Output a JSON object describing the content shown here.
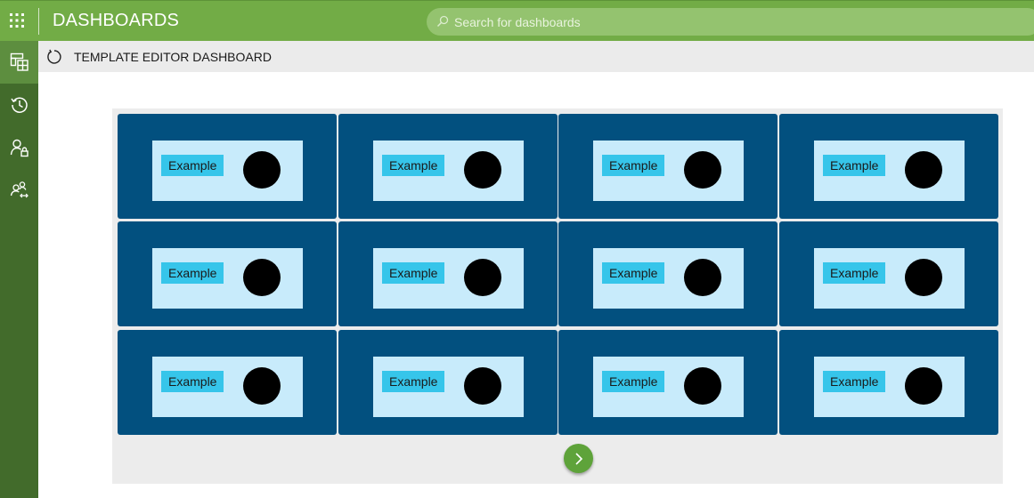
{
  "header": {
    "app_title": "DASHBOARDS",
    "search_placeholder": "Search for dashboards",
    "search_value": ""
  },
  "sidebar": {
    "items": [
      {
        "icon": "dashboard-layout-icon",
        "active": true
      },
      {
        "icon": "history-icon",
        "active": false
      },
      {
        "icon": "user-lock-icon",
        "active": false
      },
      {
        "icon": "users-share-icon",
        "active": false
      }
    ]
  },
  "subheader": {
    "title": "TEMPLATE EDITOR DASHBOARD",
    "refresh_icon": "refresh-icon"
  },
  "dashboard": {
    "tiles": [
      {
        "label": "Example"
      },
      {
        "label": "Example"
      },
      {
        "label": "Example"
      },
      {
        "label": "Example"
      },
      {
        "label": "Example"
      },
      {
        "label": "Example"
      },
      {
        "label": "Example"
      },
      {
        "label": "Example"
      },
      {
        "label": "Example"
      },
      {
        "label": "Example"
      },
      {
        "label": "Example"
      },
      {
        "label": "Example"
      }
    ],
    "next_icon": "chevron-right-icon"
  },
  "colors": {
    "topbar": "#72ac46",
    "sidebar": "#426b2b",
    "tile": "#02507f",
    "tile_inner": "#c8ebfb",
    "badge": "#36c5ea",
    "next_button": "#5ea33a"
  }
}
